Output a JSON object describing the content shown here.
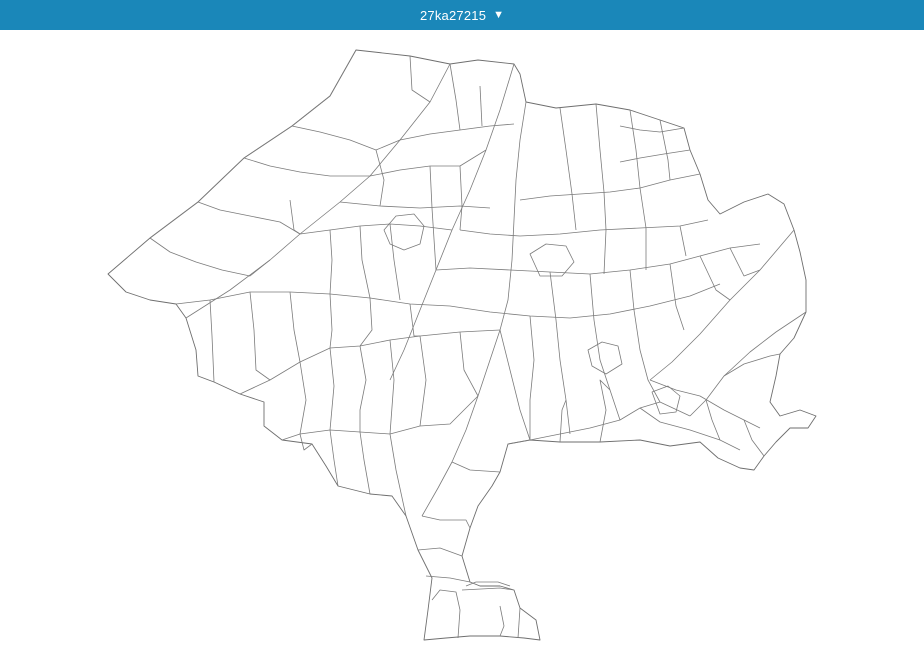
{
  "header": {
    "region_code": "27ka27215",
    "dropdown_icon": "caret-down-icon"
  },
  "colors": {
    "header_bg": "#1a87b9",
    "header_text": "#ffffff",
    "boundary_stroke": "#7b7b7b",
    "map_fill": "#ffffff"
  }
}
